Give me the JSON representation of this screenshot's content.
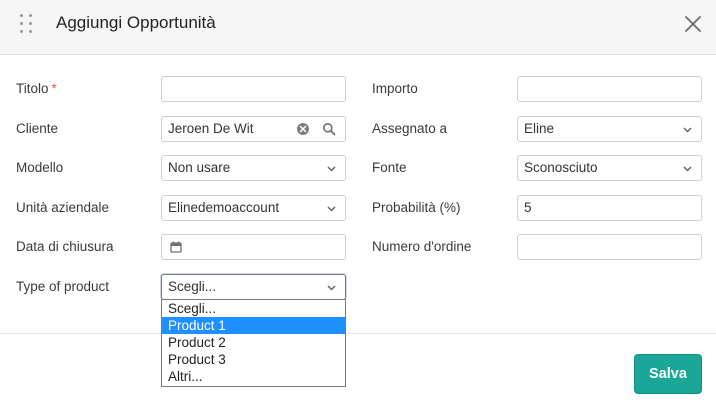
{
  "dialog": {
    "title": "Aggiungi Opportunità"
  },
  "form": {
    "titolo": {
      "label": "Titolo",
      "required_mark": "*",
      "value": ""
    },
    "cliente": {
      "label": "Cliente",
      "value": "Jeroen De Wit"
    },
    "modello": {
      "label": "Modello",
      "value": "Non usare"
    },
    "unita": {
      "label": "Unità aziendale",
      "value": "Elinedemoaccount"
    },
    "data_chiusura": {
      "label": "Data di chiusura",
      "value": ""
    },
    "type_of_product": {
      "label": "Type of product",
      "value": "Scegli...",
      "options": [
        "Scegli...",
        "Product 1",
        "Product 2",
        "Product 3",
        "Altri..."
      ],
      "highlighted_option": "Product 1"
    },
    "importo": {
      "label": "Importo",
      "value": ""
    },
    "assegnato": {
      "label": "Assegnato a",
      "value": "Eline"
    },
    "fonte": {
      "label": "Fonte",
      "value": "Sconosciuto"
    },
    "probabilita": {
      "label": "Probabilità (%)",
      "value": "5"
    },
    "numero_ordine": {
      "label": "Numero d'ordine",
      "value": ""
    }
  },
  "footer": {
    "save_label": "Salva"
  },
  "colors": {
    "accent": "#1aa79a",
    "required": "#e05a4f",
    "highlight": "#1e90ff"
  },
  "icons": [
    "drag-handle-icon",
    "close-icon",
    "clear-icon",
    "search-icon",
    "calendar-icon",
    "chevron-down-icon"
  ]
}
